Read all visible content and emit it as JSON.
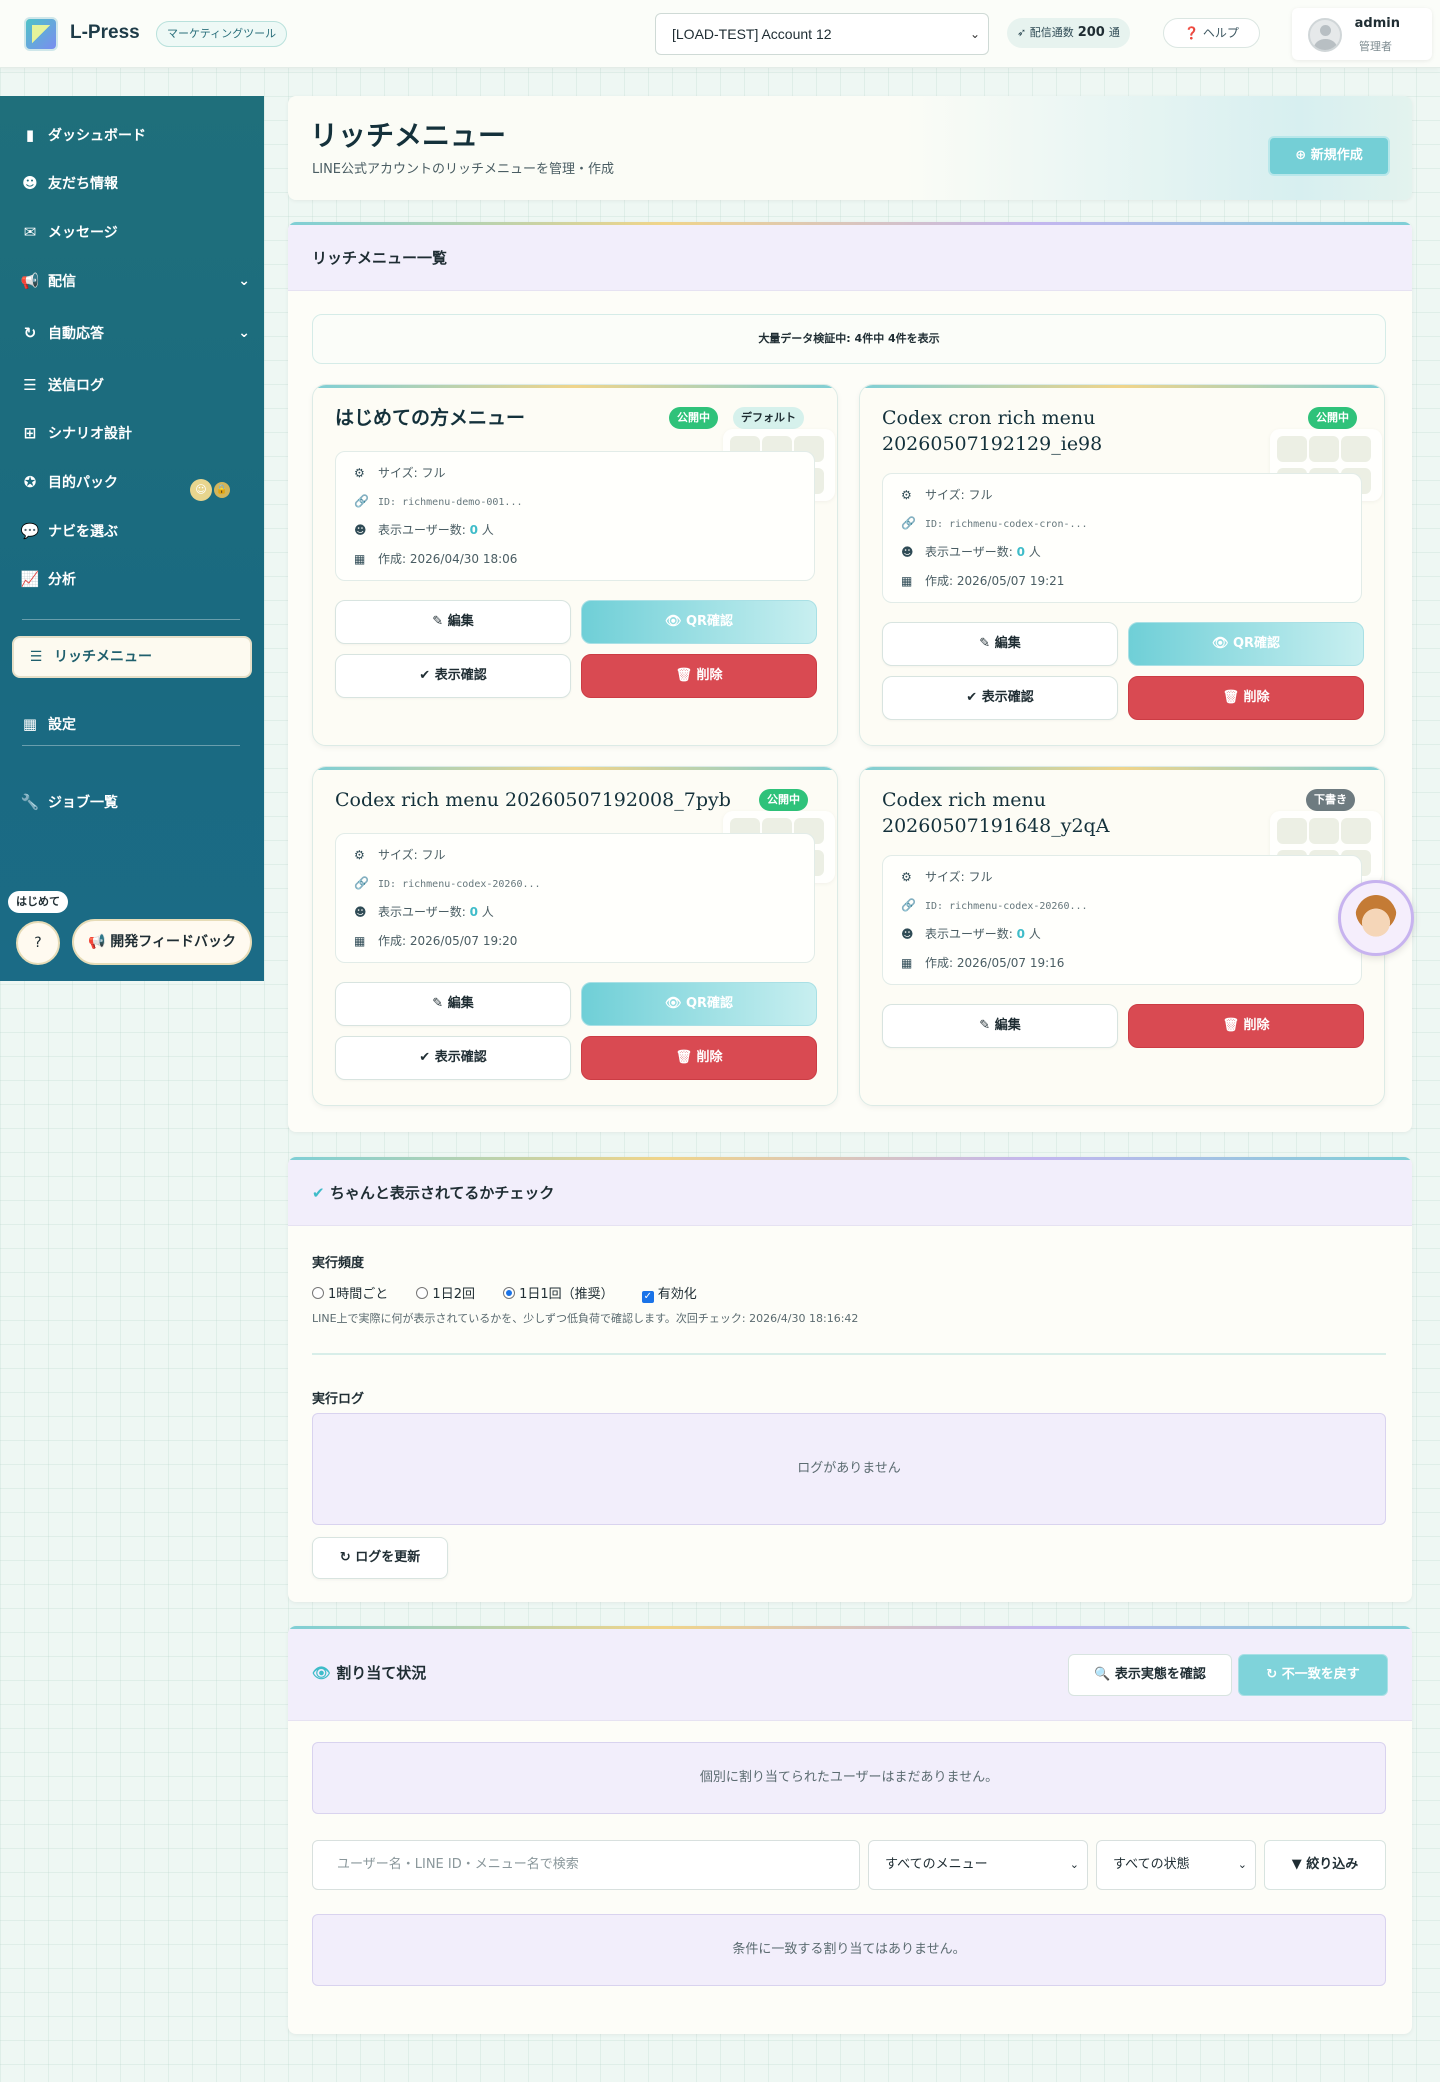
{
  "header": {
    "brand": "L-Press",
    "brand_tag": "マーケティングツール",
    "account_selected": "[LOAD-TEST] Account 12",
    "quota_label": "配信通数",
    "quota_value": "200",
    "quota_unit": "通",
    "help_label": "ヘルプ",
    "user_name": "admin",
    "user_role": "管理者"
  },
  "sidebar": {
    "items": [
      {
        "label": "ダッシュボード",
        "icon": "bar-chart-icon"
      },
      {
        "label": "友だち情報",
        "icon": "users-icon"
      },
      {
        "label": "メッセージ",
        "icon": "chat-icon"
      },
      {
        "label": "配信",
        "icon": "megaphone-icon"
      },
      {
        "label": "自動応答",
        "icon": "refresh-icon"
      },
      {
        "label": "送信ログ",
        "icon": "list-icon"
      },
      {
        "label": "シナリオ設計",
        "icon": "sitemap-icon"
      },
      {
        "label": "目的パック",
        "icon": "award-icon"
      },
      {
        "label": "ナビを選ぶ",
        "icon": "comment-icon"
      },
      {
        "label": "分析",
        "icon": "line-chart-icon"
      },
      {
        "label": "リッチメニュー",
        "icon": "menu-icon"
      },
      {
        "label": "設定",
        "icon": "grid-icon"
      },
      {
        "label": "ジョブ一覧",
        "icon": "wrench-icon"
      }
    ],
    "beginner_tag": "はじめて",
    "feedback_label": "開発フィードバック"
  },
  "page": {
    "title": "リッチメニュー",
    "subtitle": "LINE公式アカウントのリッチメニューを管理・作成",
    "new_button": "新規作成"
  },
  "list": {
    "title": "リッチメニュー一覧",
    "notice": "大量データ検証中: 4件中 4件を表示",
    "size_prefix": "サイズ: ",
    "users_prefix": "表示ユーザー数: ",
    "users_unit": " 人",
    "created_prefix": "作成: ",
    "btn_edit": "編集",
    "btn_qr": "QR確認",
    "btn_preview": "表示確認",
    "btn_delete": "削除",
    "cards": [
      {
        "name": "はじめての方メニュー",
        "status": "公開中",
        "default": "デフォルト",
        "size": "フル",
        "id": "ID: richmenu-demo-001...",
        "users": "0",
        "created": "2026/04/30 18:06"
      },
      {
        "name": "Codex cron rich menu 20260507192129_ie98",
        "status": "公開中",
        "size": "フル",
        "id": "ID: richmenu-codex-cron-...",
        "users": "0",
        "created": "2026/05/07 19:21"
      },
      {
        "name": "Codex rich menu 20260507192008_7pyb",
        "status": "公開中",
        "size": "フル",
        "id": "ID: richmenu-codex-20260...",
        "users": "0",
        "created": "2026/05/07 19:20"
      },
      {
        "name": "Codex rich menu 20260507191648_y2qA",
        "status": "下書き",
        "size": "フル",
        "id": "ID: richmenu-codex-20260...",
        "users": "0",
        "created": "2026/05/07 19:16"
      }
    ]
  },
  "check": {
    "title": "ちゃんと表示されてるかチェック",
    "freq_label": "実行頻度",
    "options": [
      "1時間ごと",
      "1日2回",
      "1日1回（推奨）"
    ],
    "selected": "1日1回（推奨）",
    "enabled_label": "有効化",
    "note": "LINE上で実際に何が表示されているかを、少しずつ低負荷で確認します。次回チェック: 2026/4/30 18:16:42",
    "log_label": "実行ログ",
    "log_empty": "ログがありません",
    "refresh_label": "ログを更新"
  },
  "assign": {
    "title": "割り当て状況",
    "btn_check": "表示実態を確認",
    "btn_revert": "不一致を戻す",
    "empty_users": "個別に割り当てられたユーザーはまだありません。",
    "search_placeholder": "ユーザー名・LINE ID・メニュー名で検索",
    "menu_filter": "すべてのメニュー",
    "status_filter": "すべての状態",
    "filter_btn": "絞り込み",
    "empty_result": "条件に一致する割り当てはありません。"
  }
}
